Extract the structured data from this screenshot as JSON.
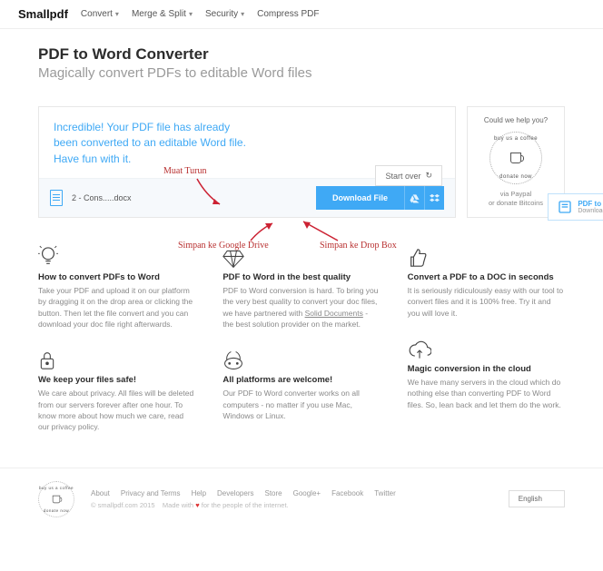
{
  "brand": "Smallpdf",
  "nav": {
    "convert": "Convert",
    "merge": "Merge & Split",
    "security": "Security",
    "compress": "Compress PDF"
  },
  "page": {
    "title": "PDF to Word Converter",
    "subtitle": "Magically convert PDFs to editable Word files"
  },
  "panel": {
    "success": "Incredible! Your PDF file has already been converted to an editable Word file. Have fun with it.",
    "start_over": "Start over",
    "filename": "2 - Cons.....docx",
    "download": "Download File"
  },
  "side": {
    "help": "Could we help you?",
    "badge_top": "buy us a coffee",
    "badge_bot": "donate now",
    "via": "via Paypal",
    "via2": "or donate Bitcoins"
  },
  "promo": {
    "title": "PDF to Office Software",
    "sub": "Download here »"
  },
  "annot": {
    "muat": "Muat Turun",
    "drive": "Simpan ke Google Drive",
    "dropbox": "Simpan ke Drop Box"
  },
  "features": {
    "f1": {
      "title": "How to convert PDFs to Word",
      "desc": "Take your PDF and upload it on our platform by dragging it on the drop area or clicking the button. Then let the file convert and you can download your doc file right afterwards."
    },
    "f2": {
      "title": "We keep your files safe!",
      "desc": "We care about privacy. All files will be deleted from our servers forever after one hour. To know more about how much we care, read our privacy policy."
    },
    "f3": {
      "title": "PDF to Word in the best quality",
      "desc_pre": "PDF to Word conversion is hard. To bring you the very best quality to convert your doc files, we have partnered with ",
      "link": "Solid Documents",
      "desc_post": " - the best solution provider on the market."
    },
    "f4": {
      "title": "All platforms are welcome!",
      "desc": "Our PDF to Word converter works on all computers - no matter if you use Mac, Windows or Linux."
    },
    "f5": {
      "title": "Convert a PDF to a DOC in seconds",
      "desc": "It is seriously ridiculously easy with our tool to convert files and it is 100% free. Try it and you will love it."
    },
    "f6": {
      "title": "Magic conversion in the cloud",
      "desc": "We have many servers in the cloud which do nothing else than converting PDF to Word files. So, lean back and let them do the work."
    }
  },
  "footer": {
    "links": {
      "about": "About",
      "privacy": "Privacy and Terms",
      "help": "Help",
      "developers": "Developers",
      "store": "Store",
      "google": "Google+",
      "facebook": "Facebook",
      "twitter": "Twitter"
    },
    "copy_pre": "© smallpdf.com 2015",
    "copy_mid": "Made with",
    "copy_post": "for the people of the internet.",
    "lang": "English"
  }
}
